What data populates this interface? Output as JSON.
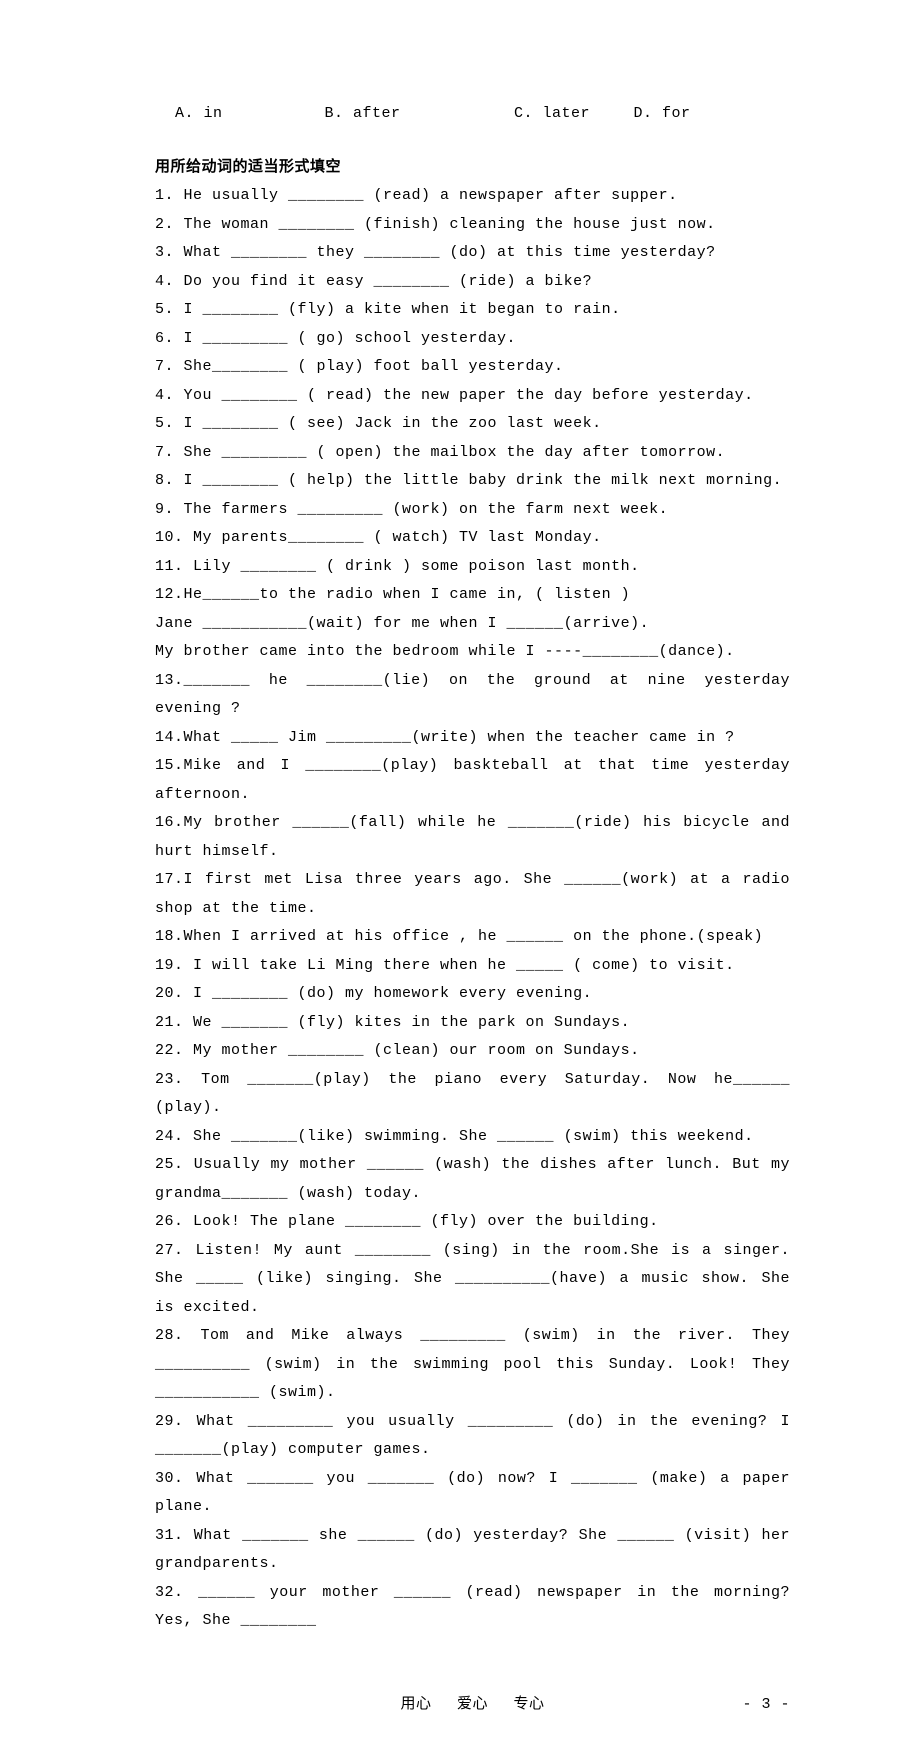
{
  "options": {
    "a": "A. in",
    "b": "B. after",
    "c": "C. later",
    "d": "D. for"
  },
  "section_title": "用所给动词的适当形式填空",
  "items": [
    "1. He usually ________ (read) a newspaper after supper.",
    "2. The woman ________ (finish) cleaning the house just now.",
    "3. What ________ they ________ (do) at this time yesterday?",
    "4. Do you find it easy ________ (ride) a bike?",
    "5. I ________ (fly) a kite when it began to rain.",
    "6. I _________ ( go) school yesterday.",
    "7. She________ ( play) foot ball yesterday.",
    "4. You ________ ( read) the new paper the day before yesterday.",
    "5. I ________ ( see) Jack in the zoo last week.",
    "7. She _________ ( open) the mailbox the day after tomorrow.",
    "8. I ________ ( help) the little baby drink the milk next morning.",
    "9. The farmers _________ (work) on the farm next week.",
    "10. My parents________ ( watch) TV last Monday.",
    "11. Lily ________ ( drink ) some poison last month.",
    "12.He______to the radio when I came in, ( listen )",
    "Jane ___________(wait) for me when I ______(arrive).",
    "My brother came into the bedroom while I ----________(dance).",
    "13._______ he ________(lie) on the ground at nine yesterday evening ?",
    "14.What _____ Jim _________(write) when the teacher came in ?",
    "15.Mike and I ________(play) baskteball at that time yesterday afternoon.",
    "16.My brother ______(fall) while he _______(ride) his bicycle and hurt himself.",
    "17.I first met Lisa three years ago. She ______(work) at a radio shop at the time.",
    "18.When I arrived at his office , he ______ on the phone.(speak)",
    "19. I will take Li Ming there when he _____ ( come) to visit.",
    "20. I ________ (do) my homework every evening.",
    "21. We _______ (fly) kites in the park on Sundays.",
    "22. My mother ________ (clean) our room on Sundays.",
    "23. Tom _______(play) the piano every Saturday. Now he______ (play).",
    "24. She _______(like) swimming. She ______ (swim) this weekend.",
    "25. Usually my mother ______ (wash) the dishes after lunch. But my grandma_______ (wash) today.",
    "26. Look! The plane ________ (fly) over the building.",
    "27. Listen! My aunt ________ (sing) in the room.She is a singer. She _____ (like) singing. She __________(have) a music show. She is excited.",
    "28. Tom and Mike always _________ (swim) in the river. They __________ (swim) in the swimming pool this Sunday. Look! They ___________ (swim).",
    "29. What _________ you usually _________ (do) in the evening? I _______(play) computer games.",
    "30. What _______ you _______ (do) now? I _______ (make) a paper plane.",
    "31. What _______ she ______ (do) yesterday? She ______ (visit) her grandparents.",
    "32. ______ your mother ______ (read) newspaper in the morning? Yes, She ________"
  ],
  "footer": {
    "c1": "用心",
    "c2": "爱心",
    "c3": "专心",
    "page": "- 3 -"
  }
}
